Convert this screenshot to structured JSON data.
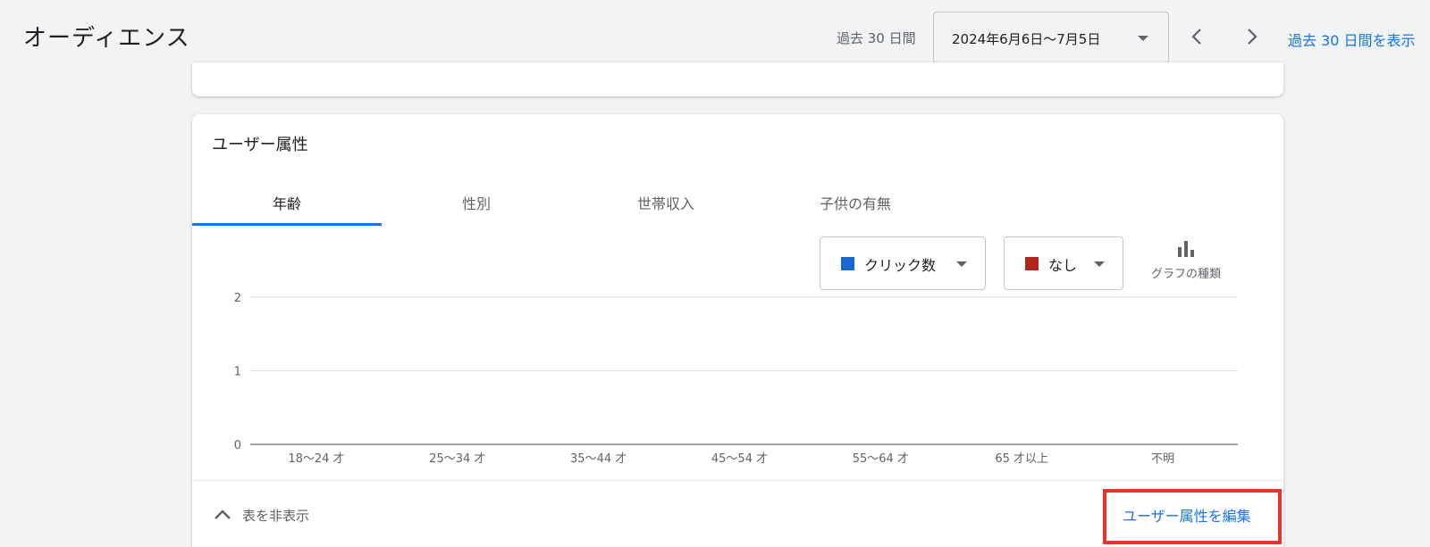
{
  "header": {
    "title": "オーディエンス",
    "range_label": "過去 30 日間",
    "date_range": "2024年6月6日〜7月5日",
    "show_link": "過去 30 日間を表示"
  },
  "card": {
    "title": "ユーザー属性",
    "tabs": [
      {
        "label": "年齢",
        "active": true
      },
      {
        "label": "性別",
        "active": false
      },
      {
        "label": "世帯収入",
        "active": false
      },
      {
        "label": "子供の有無",
        "active": false
      }
    ],
    "metric_primary": {
      "label": "クリック数",
      "color": "#1a67d2"
    },
    "metric_secondary": {
      "label": "なし",
      "color": "#b3261e"
    },
    "chart_type_label": "グラフの種類",
    "hide_table_label": "表を非表示",
    "edit_link": "ユーザー属性を編集"
  },
  "chart_data": {
    "type": "bar",
    "categories": [
      "18〜24 才",
      "25〜34 才",
      "35〜44 才",
      "45〜54 才",
      "55〜64 才",
      "65 才以上",
      "不明"
    ],
    "series": [
      {
        "name": "クリック数",
        "values": [
          0,
          0,
          0,
          0,
          0,
          0,
          0
        ]
      }
    ],
    "y_ticks": [
      "0",
      "1",
      "2"
    ],
    "ylim": [
      0,
      2
    ],
    "grid": true,
    "title": "",
    "xlabel": "",
    "ylabel": ""
  }
}
